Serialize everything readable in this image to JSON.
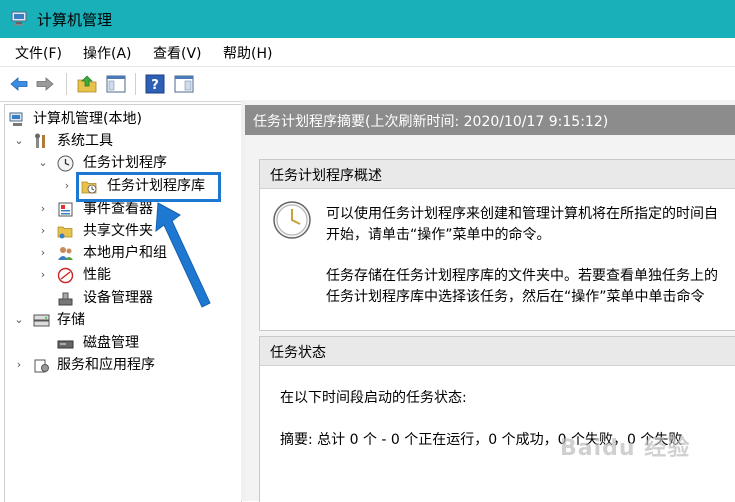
{
  "window": {
    "title": "计算机管理"
  },
  "menu": [
    "文件(F)",
    "操作(A)",
    "查看(V)",
    "帮助(H)"
  ],
  "toolbar": {
    "buttons": [
      "back-arrow-icon",
      "forward-arrow-icon",
      "up-folder-icon",
      "show-hide-tree-icon",
      "help-icon",
      "properties-icon"
    ]
  },
  "tree": {
    "root": "计算机管理(本地)",
    "system_tools": "系统工具",
    "task_scheduler": "任务计划程序",
    "task_scheduler_library": "任务计划程序库",
    "event_viewer": "事件查看器",
    "shared_folders": "共享文件夹",
    "local_users_groups": "本地用户和组",
    "performance": "性能",
    "device_manager": "设备管理器",
    "storage": "存储",
    "disk_management": "磁盘管理",
    "services_apps": "服务和应用程序"
  },
  "main": {
    "summary_title": "任务计划程序摘要(上次刷新时间: 2020/10/17 9:15:12)",
    "overview": {
      "title": "任务计划程序概述",
      "line1": "可以使用任务计划程序来创建和管理计算机将在所指定的时间自",
      "line2": "开始，请单击“操作”菜单中的命令。",
      "line3": "任务存储在任务计划程序库的文件夹中。若要查看单独任务上的",
      "line4": "任务计划程序库中选择该任务，然后在“操作”菜单中单击命令"
    },
    "status": {
      "title": "任务状态",
      "line1": "在以下时间段启动的任务状态:",
      "line2": "摘要: 总计 0 个 - 0 个正在运行，0 个成功，0 个失败，0 个失败"
    }
  },
  "watermark": "Baidu 经验",
  "colors": {
    "titlebar": "#1ab0b9",
    "highlight": "#1e78d2",
    "summary_bar": "#8c8c8c"
  }
}
